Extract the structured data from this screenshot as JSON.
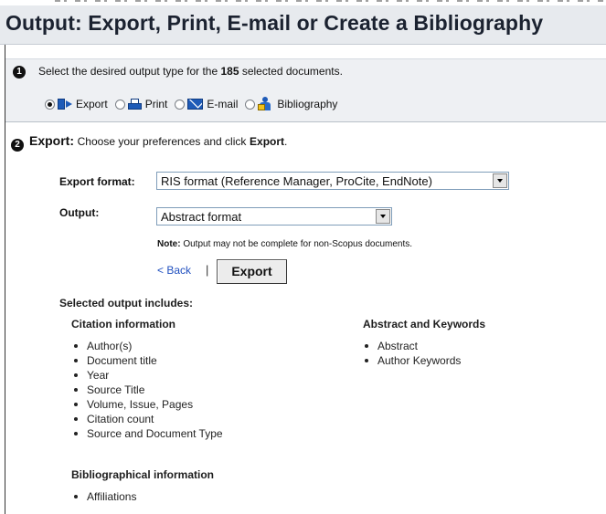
{
  "page": {
    "title": "Output: Export, Print, E-mail or Create a Bibliography"
  },
  "step1": {
    "number": "1",
    "text_prefix": "Select the desired output type for the",
    "count": "185",
    "text_suffix": "selected documents.",
    "options": [
      {
        "label": "Export",
        "icon": "export-icon",
        "checked": true
      },
      {
        "label": "Print",
        "icon": "print-icon",
        "checked": false
      },
      {
        "label": "E-mail",
        "icon": "email-icon",
        "checked": false
      },
      {
        "label": "Bibliography",
        "icon": "bibliography-icon",
        "checked": false
      }
    ]
  },
  "step2": {
    "number": "2",
    "heading": "Export:",
    "instruction_prefix": "Choose your preferences and click",
    "instruction_bold": "Export",
    "instruction_suffix": "."
  },
  "form": {
    "export_format_label": "Export format:",
    "export_format_value": "RIS format (Reference Manager, ProCite, EndNote)",
    "output_label": "Output:",
    "output_value": "Abstract format",
    "note_label": "Note:",
    "note_text": "Output may not be complete for non-Scopus documents.",
    "back_label": "< Back",
    "separator": "|",
    "export_button": "Export"
  },
  "includes": {
    "heading": "Selected output includes:",
    "citation": {
      "heading": "Citation information",
      "items": [
        "Author(s)",
        "Document title",
        "Year",
        "Source Title",
        "Volume, Issue, Pages",
        "Citation count",
        "Source and Document Type"
      ]
    },
    "abstract": {
      "heading": "Abstract and Keywords",
      "items": [
        "Abstract",
        "Author Keywords"
      ]
    },
    "bibliographical": {
      "heading": "Bibliographical information",
      "items": [
        "Affiliations"
      ]
    }
  },
  "colors": {
    "title_bar_bg": "#e7eaee",
    "step_bg": "#eef0f3",
    "link": "#1f4fbf",
    "icon_blue": "#1e5bb8"
  }
}
